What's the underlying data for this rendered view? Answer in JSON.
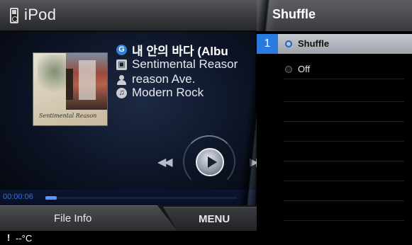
{
  "header": {
    "app_title": "iPod",
    "panel_title": "Shuffle"
  },
  "now_playing": {
    "title": "내 안의 바다 (Albu",
    "album": "Sentimental Reasor",
    "artist": "reason Ave.",
    "genre": "Modern Rock",
    "elapsed": "00:00:06",
    "progress": 0.03,
    "album_art_signature": "Sentimental Reason"
  },
  "controls": {
    "prev_symbol": "◀◀",
    "next_symbol": "▶▶"
  },
  "tabs": [
    {
      "label": "File Info"
    },
    {
      "label": "MENU"
    }
  ],
  "status": {
    "warning": "!",
    "temperature": "--°C"
  },
  "options": {
    "selected_index": "1",
    "items": [
      {
        "label": "Shuffle",
        "selected": true
      },
      {
        "label": "Off",
        "selected": false
      }
    ]
  },
  "colors": {
    "accent": "#2a7be0",
    "selection": "#b5b9c0",
    "progress": "#5c93ff"
  }
}
